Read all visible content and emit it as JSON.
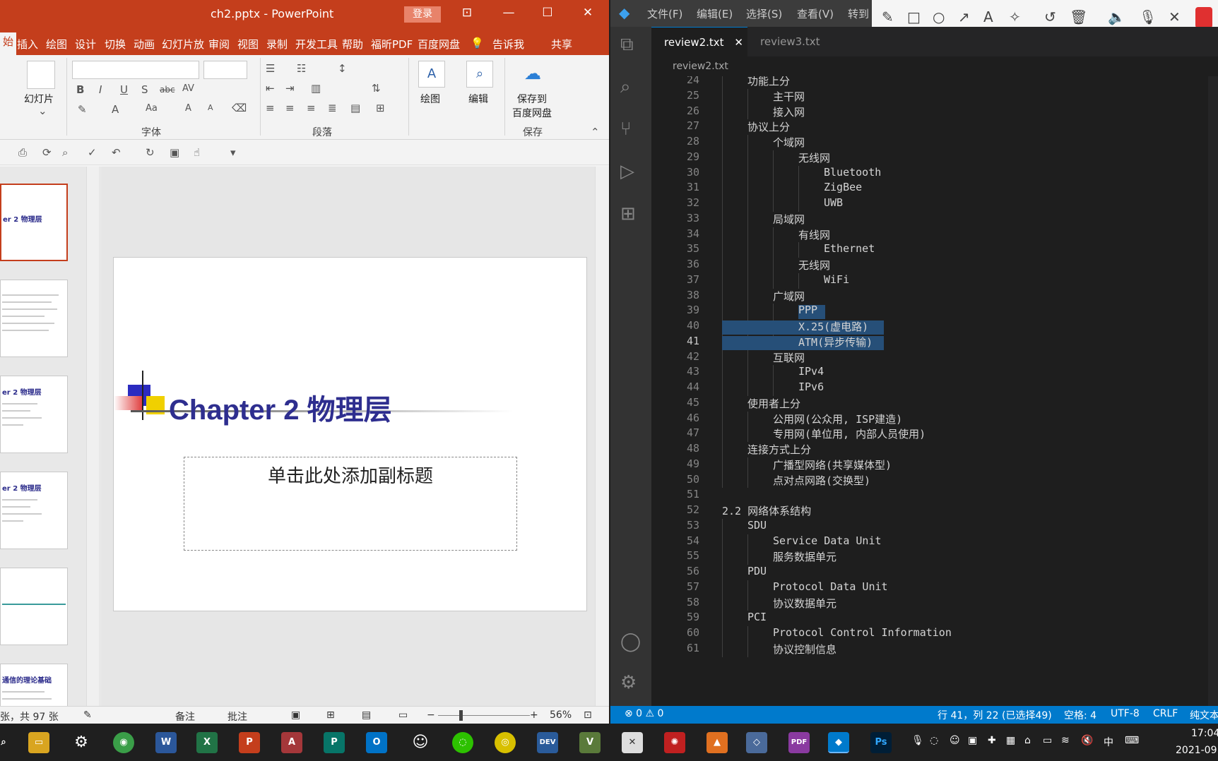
{
  "ppt": {
    "window_title": "ch2.pptx  -  PowerPoint",
    "login_label": "登录",
    "tabs": [
      "始",
      "插入",
      "绘图",
      "设计",
      "切换",
      "动画",
      "幻灯片放",
      "审阅",
      "视图",
      "录制",
      "开发工具",
      "帮助",
      "福昕PDF",
      "百度网盘"
    ],
    "tell_me": "告诉我",
    "share": "共享",
    "ribbon": {
      "slides_label": "幻灯片",
      "font_group": "字体",
      "paragraph_group": "段落",
      "draw_label": "绘图",
      "edit_label": "编辑",
      "save_to_label": "保存到",
      "baidu_label": "百度网盘",
      "save_group": "保存"
    },
    "slide": {
      "title": "Chapter 2 物理层",
      "subtitle_placeholder": "单击此处添加副标题"
    },
    "thumbs": [
      {
        "title": "er 2 物理层"
      },
      {
        "title": ""
      },
      {
        "title": "er 2 物理层"
      },
      {
        "title": "er 2 物理层"
      },
      {
        "title": ""
      },
      {
        "title": "通信的理论基础"
      }
    ],
    "status": {
      "slide_count": "张，共 97 张",
      "notes": "备注",
      "comments": "批注",
      "zoom": "56%"
    }
  },
  "vscode": {
    "menu": [
      "文件(F)",
      "编辑(E)",
      "选择(S)",
      "查看(V)",
      "转到"
    ],
    "tabs": [
      {
        "label": "review2.txt",
        "active": true
      },
      {
        "label": "review3.txt",
        "active": false
      }
    ],
    "breadcrumb": "review2.txt",
    "lines": [
      {
        "n": "24",
        "indent": 1,
        "text": "功能上分"
      },
      {
        "n": "25",
        "indent": 2,
        "text": "主干网"
      },
      {
        "n": "26",
        "indent": 2,
        "text": "接入网"
      },
      {
        "n": "27",
        "indent": 1,
        "text": "协议上分"
      },
      {
        "n": "28",
        "indent": 2,
        "text": "个域网"
      },
      {
        "n": "29",
        "indent": 3,
        "text": "无线网"
      },
      {
        "n": "30",
        "indent": 4,
        "text": "Bluetooth"
      },
      {
        "n": "31",
        "indent": 4,
        "text": "ZigBee"
      },
      {
        "n": "32",
        "indent": 4,
        "text": "UWB"
      },
      {
        "n": "33",
        "indent": 2,
        "text": "局域网"
      },
      {
        "n": "34",
        "indent": 3,
        "text": "有线网"
      },
      {
        "n": "35",
        "indent": 4,
        "text": "Ethernet"
      },
      {
        "n": "36",
        "indent": 3,
        "text": "无线网"
      },
      {
        "n": "37",
        "indent": 4,
        "text": "WiFi"
      },
      {
        "n": "38",
        "indent": 2,
        "text": "广域网"
      },
      {
        "n": "39",
        "indent": 3,
        "text": "PPP"
      },
      {
        "n": "40",
        "indent": 3,
        "text": "X.25(虚电路)"
      },
      {
        "n": "41",
        "indent": 3,
        "text": "ATM(异步传输)"
      },
      {
        "n": "42",
        "indent": 2,
        "text": "互联网"
      },
      {
        "n": "43",
        "indent": 3,
        "text": "IPv4"
      },
      {
        "n": "44",
        "indent": 3,
        "text": "IPv6"
      },
      {
        "n": "45",
        "indent": 1,
        "text": "使用者上分"
      },
      {
        "n": "46",
        "indent": 2,
        "text": "公用网(公众用, ISP建造)"
      },
      {
        "n": "47",
        "indent": 2,
        "text": "专用网(单位用, 内部人员使用)"
      },
      {
        "n": "48",
        "indent": 1,
        "text": "连接方式上分"
      },
      {
        "n": "49",
        "indent": 2,
        "text": "广播型网络(共享媒体型)"
      },
      {
        "n": "50",
        "indent": 2,
        "text": "点对点网路(交换型)"
      },
      {
        "n": "51",
        "indent": 0,
        "text": ""
      },
      {
        "n": "52",
        "indent": 0,
        "text": "2.2 网络体系结构"
      },
      {
        "n": "53",
        "indent": 1,
        "text": "SDU"
      },
      {
        "n": "54",
        "indent": 2,
        "text": "Service Data Unit"
      },
      {
        "n": "55",
        "indent": 2,
        "text": "服务数据单元"
      },
      {
        "n": "56",
        "indent": 1,
        "text": "PDU"
      },
      {
        "n": "57",
        "indent": 2,
        "text": "Protocol Data Unit"
      },
      {
        "n": "58",
        "indent": 2,
        "text": "协议数据单元"
      },
      {
        "n": "59",
        "indent": 1,
        "text": "PCI"
      },
      {
        "n": "60",
        "indent": 2,
        "text": "Protocol Control Information"
      },
      {
        "n": "61",
        "indent": 2,
        "text": "协议控制信息"
      }
    ],
    "status": {
      "problems": "⊗ 0 ⚠ 0",
      "position": "行 41，列 22 (已选择49)",
      "spaces": "空格: 4",
      "encoding": "UTF-8",
      "eol": "CRLF",
      "lang": "纯文本"
    }
  },
  "taskbar": {
    "ime": "中",
    "clock_time": "17:04",
    "clock_date": "2021-09"
  },
  "colors": {
    "ppt_accent": "#c43e1c",
    "vscode_status": "#007acc",
    "selection": "#264f78"
  }
}
